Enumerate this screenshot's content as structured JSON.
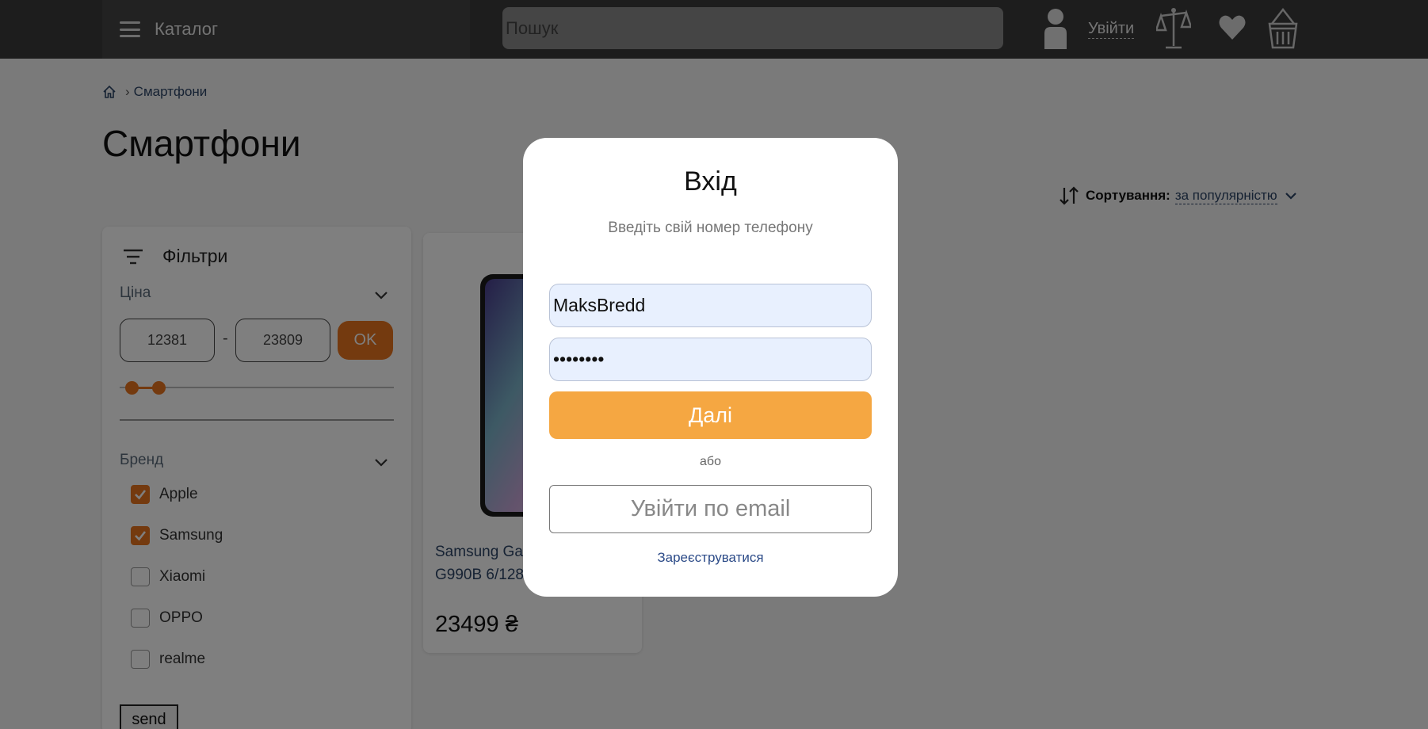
{
  "header": {
    "catalog_label": "Каталог",
    "search_placeholder": "Пошук",
    "login_label": "Увійти"
  },
  "breadcrumb": {
    "items": [
      "Смартфони"
    ]
  },
  "page": {
    "title": "Смартфони"
  },
  "sort": {
    "label": "Сортування:",
    "value": "за популярністю"
  },
  "filters": {
    "title": "Фільтри",
    "price": {
      "title": "Ціна",
      "min": "12381",
      "max": "23809",
      "separator": "-",
      "ok_label": "OK"
    },
    "brand": {
      "title": "Бренд",
      "items": [
        {
          "label": "Apple",
          "checked": true
        },
        {
          "label": "Samsung",
          "checked": true
        },
        {
          "label": "Xiaomi",
          "checked": false
        },
        {
          "label": "OPPO",
          "checked": false
        },
        {
          "label": "realme",
          "checked": false
        }
      ]
    },
    "send_label": "send"
  },
  "product": {
    "name": "Samsung Galaxy S21 FE G990B 6/128GB",
    "price": "23499 ₴"
  },
  "modal": {
    "title": "Вхід",
    "subtitle": "Введіть свій номер телефону",
    "login_value": "MaksBredd",
    "password_value": "bredd123",
    "next_label": "Далі",
    "or_label": "або",
    "email_label": "Увійти по email",
    "register_label": "Зареєструватися"
  },
  "colors": {
    "accent": "#e8741e",
    "next_button": "#f5a742",
    "header_bg": "#3a3a3a",
    "link": "#2c4466"
  }
}
